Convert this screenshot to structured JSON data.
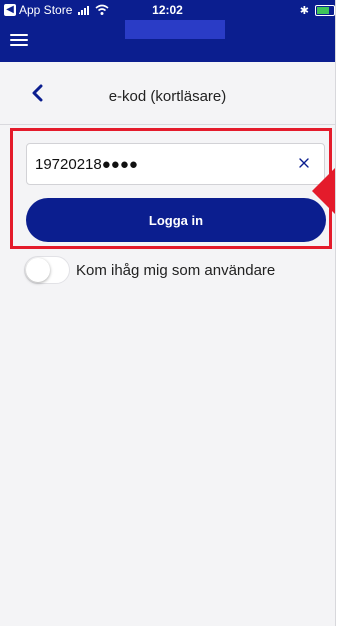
{
  "status_bar": {
    "back_app": "App Store",
    "time": "12:02"
  },
  "header": {
    "title": "e-kod (kortläsare)"
  },
  "form": {
    "code_value": "19720218●●●●",
    "login_label": "Logga in",
    "remember_label": "Kom ihåg mig som användare",
    "remember_on": false
  },
  "colors": {
    "brand_navy": "#0b1e8f",
    "highlight_red": "#e41b2b",
    "logo_placeholder": "#2a3cc6"
  },
  "icons": {
    "menu": "hamburger-menu-icon",
    "back": "chevron-left-icon",
    "clear": "close-x-icon",
    "annotation": "red-arrow-icon"
  }
}
